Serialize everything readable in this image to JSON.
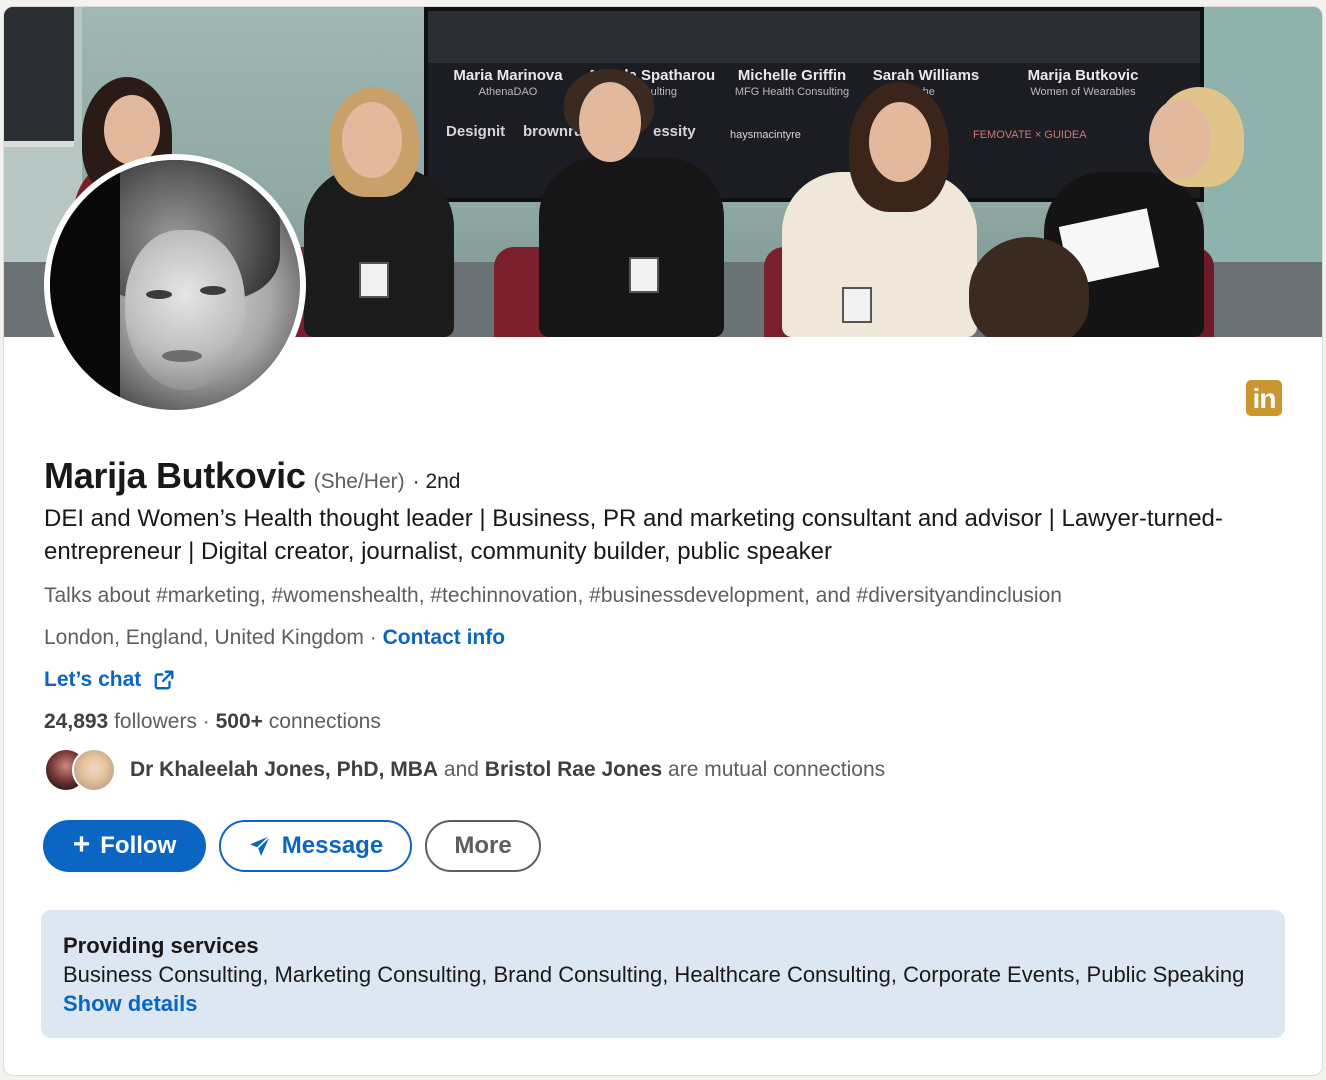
{
  "banner": {
    "speakers": [
      {
        "name": "Maria Marinova",
        "org": "AthenaDAO"
      },
      {
        "name": "Angela Spatharou",
        "org": "Consulting"
      },
      {
        "name": "Michelle Griffin",
        "org": "MFG Health Consulting"
      },
      {
        "name": "Sarah Williams",
        "org": "che"
      },
      {
        "name": "Marija Butkovic",
        "org": "Women of Wearables"
      }
    ],
    "sponsor_logos": [
      "Designit",
      "brownrudnick",
      "essity",
      "haysmacintyre",
      "FEMOVATE × GUIDEA"
    ]
  },
  "profile": {
    "name": "Marija Butkovic",
    "pronouns": "(She/Her)",
    "degree": "· 2nd",
    "headline": "DEI and Women’s Health thought leader | Business, PR and marketing consultant and advisor | Lawyer-turned-entrepreneur | Digital creator, journalist, community builder, public speaker",
    "talks_about": "Talks about #marketing, #womenshealth, #techinnovation, #businessdevelopment, and #diversityandinclusion",
    "location": "London, England, United Kingdom",
    "location_sep": " · ",
    "contact_info": "Contact info",
    "website_label": "Let’s chat",
    "followers_count": "24,893",
    "followers_label": "followers",
    "stats_sep": " · ",
    "connections_count": "500+",
    "connections_label": "connections",
    "mutual": {
      "person1": "Dr Khaleelah Jones, PhD, MBA",
      "and": " and ",
      "person2": "Bristol Rae Jones",
      "suffix": " are mutual connections"
    }
  },
  "actions": {
    "follow": "Follow",
    "message": "Message",
    "more": "More"
  },
  "services": {
    "title": "Providing services",
    "list": "Business Consulting, Marketing Consulting, Brand Consulting, Healthcare Consulting, Corporate Events, Public Speaking",
    "link": "Show details"
  },
  "icons": {
    "brand_badge": "in"
  },
  "colors": {
    "accent": "#0a66c2",
    "badge": "#c9962f",
    "services_bg": "#dde7f1"
  }
}
